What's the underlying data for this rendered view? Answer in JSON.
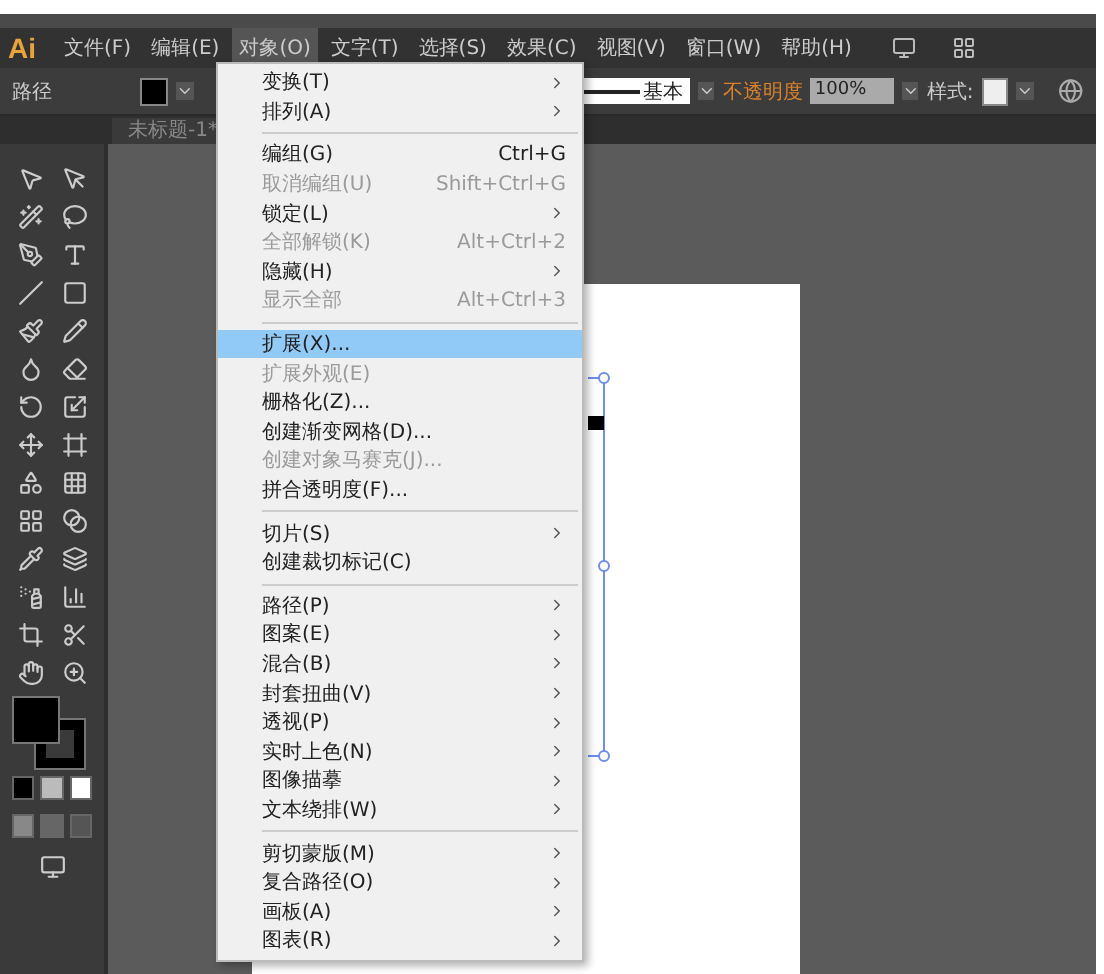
{
  "app": {
    "logo": "Ai"
  },
  "menubar": [
    {
      "label": "文件(F)",
      "selected": false
    },
    {
      "label": "编辑(E)",
      "selected": false
    },
    {
      "label": "对象(O)",
      "selected": true
    },
    {
      "label": "文字(T)",
      "selected": false
    },
    {
      "label": "选择(S)",
      "selected": false
    },
    {
      "label": "效果(C)",
      "selected": false
    },
    {
      "label": "视图(V)",
      "selected": false
    },
    {
      "label": "窗口(W)",
      "selected": false
    },
    {
      "label": "帮助(H)",
      "selected": false
    }
  ],
  "control_bar": {
    "selection_type": "路径",
    "stroke_profile": "基本",
    "opacity_label": "不透明度",
    "opacity": "100%",
    "style_label": "样式:"
  },
  "document_tab": {
    "title": "未标题-1*"
  },
  "menu": [
    {
      "kind": "item",
      "label": "变换(T)",
      "submenu": true,
      "disabled": false,
      "selected": false
    },
    {
      "kind": "item",
      "label": "排列(A)",
      "submenu": true,
      "disabled": false,
      "selected": false
    },
    {
      "kind": "separator"
    },
    {
      "kind": "item",
      "label": "编组(G)",
      "shortcut": "Ctrl+G",
      "disabled": false,
      "selected": false
    },
    {
      "kind": "item",
      "label": "取消编组(U)",
      "shortcut": "Shift+Ctrl+G",
      "disabled": true,
      "selected": false
    },
    {
      "kind": "item",
      "label": "锁定(L)",
      "submenu": true,
      "disabled": false,
      "selected": false
    },
    {
      "kind": "item",
      "label": "全部解锁(K)",
      "shortcut": "Alt+Ctrl+2",
      "disabled": true,
      "selected": false
    },
    {
      "kind": "item",
      "label": "隐藏(H)",
      "submenu": true,
      "disabled": false,
      "selected": false
    },
    {
      "kind": "item",
      "label": "显示全部",
      "shortcut": "Alt+Ctrl+3",
      "disabled": true,
      "selected": false
    },
    {
      "kind": "separator"
    },
    {
      "kind": "item",
      "label": "扩展(X)...",
      "disabled": false,
      "selected": true
    },
    {
      "kind": "item",
      "label": "扩展外观(E)",
      "disabled": true,
      "selected": false
    },
    {
      "kind": "item",
      "label": "栅格化(Z)...",
      "disabled": false,
      "selected": false
    },
    {
      "kind": "item",
      "label": "创建渐变网格(D)...",
      "disabled": false,
      "selected": false
    },
    {
      "kind": "item",
      "label": "创建对象马赛克(J)...",
      "disabled": true,
      "selected": false
    },
    {
      "kind": "item",
      "label": "拼合透明度(F)...",
      "disabled": false,
      "selected": false
    },
    {
      "kind": "separator"
    },
    {
      "kind": "item",
      "label": "切片(S)",
      "submenu": true,
      "disabled": false,
      "selected": false
    },
    {
      "kind": "item",
      "label": "创建裁切标记(C)",
      "disabled": false,
      "selected": false
    },
    {
      "kind": "separator"
    },
    {
      "kind": "item",
      "label": "路径(P)",
      "submenu": true,
      "disabled": false,
      "selected": false
    },
    {
      "kind": "item",
      "label": "图案(E)",
      "submenu": true,
      "disabled": false,
      "selected": false
    },
    {
      "kind": "item",
      "label": "混合(B)",
      "submenu": true,
      "disabled": false,
      "selected": false
    },
    {
      "kind": "item",
      "label": "封套扭曲(V)",
      "submenu": true,
      "disabled": false,
      "selected": false
    },
    {
      "kind": "item",
      "label": "透视(P)",
      "submenu": true,
      "disabled": false,
      "selected": false
    },
    {
      "kind": "item",
      "label": "实时上色(N)",
      "submenu": true,
      "disabled": false,
      "selected": false
    },
    {
      "kind": "item",
      "label": "图像描摹",
      "submenu": true,
      "disabled": false,
      "selected": false
    },
    {
      "kind": "item",
      "label": "文本绕排(W)",
      "submenu": true,
      "disabled": false,
      "selected": false
    },
    {
      "kind": "separator"
    },
    {
      "kind": "item",
      "label": "剪切蒙版(M)",
      "submenu": true,
      "disabled": false,
      "selected": false
    },
    {
      "kind": "item",
      "label": "复合路径(O)",
      "submenu": true,
      "disabled": false,
      "selected": false
    },
    {
      "kind": "item",
      "label": "画板(A)",
      "submenu": true,
      "disabled": false,
      "selected": false
    },
    {
      "kind": "item",
      "label": "图表(R)",
      "submenu": true,
      "disabled": false,
      "selected": false
    }
  ]
}
